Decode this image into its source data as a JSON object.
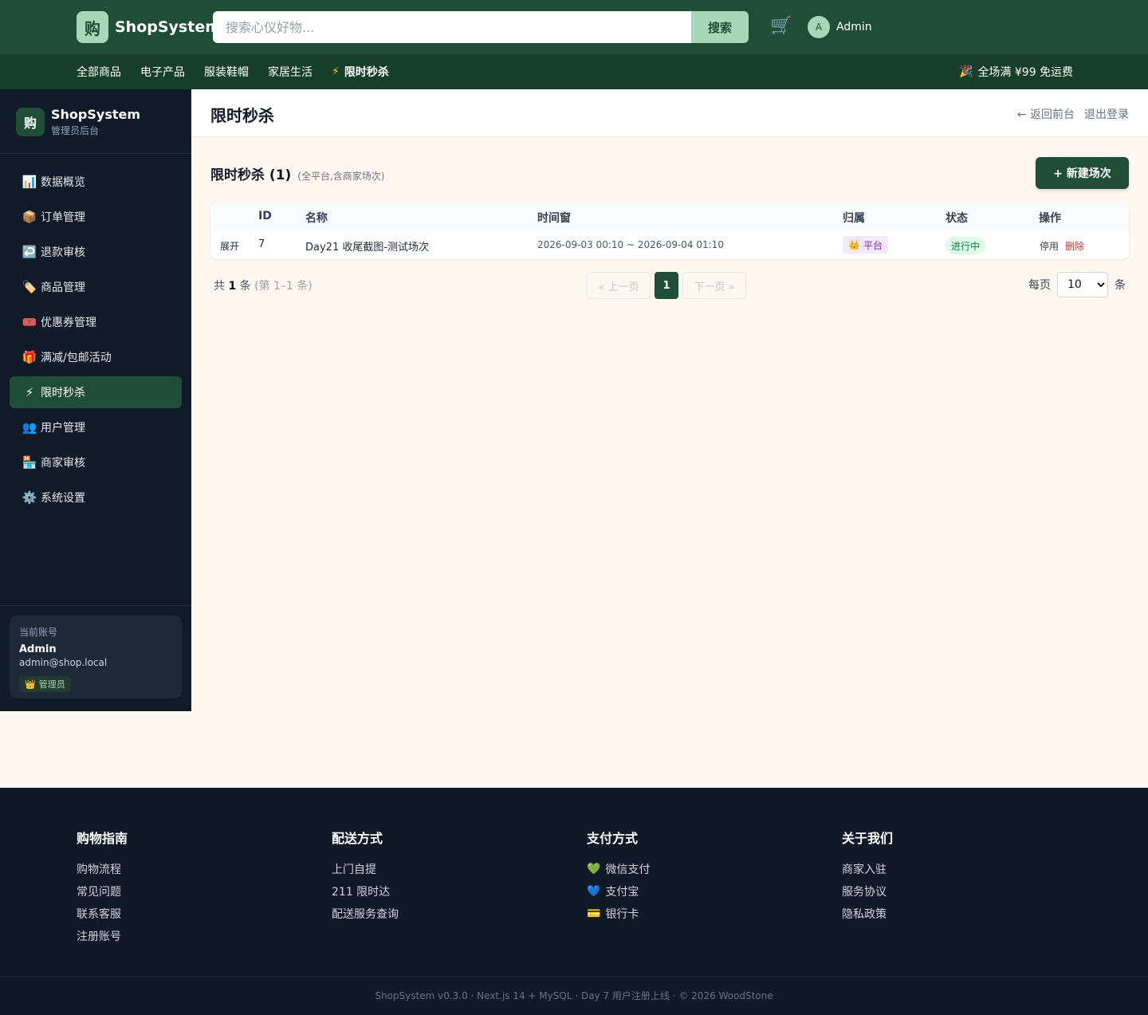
{
  "header": {
    "logo_char": "购",
    "brand": "ShopSystem",
    "search_placeholder": "搜索心仪好物...",
    "search_button": "搜索",
    "cart_icon": "🛒",
    "user_initial": "A",
    "user_name": "Admin"
  },
  "categories": [
    {
      "label": "全部商品"
    },
    {
      "label": "电子产品"
    },
    {
      "label": "服装鞋帽"
    },
    {
      "label": "家居生活"
    },
    {
      "label": "限时秒杀",
      "icon": "⚡"
    }
  ],
  "promo": {
    "icon": "🎉",
    "text": "全场满 ¥99 免运费"
  },
  "sidebar": {
    "logo_char": "购",
    "brand": "ShopSystem",
    "subtitle": "管理员后台",
    "items": [
      {
        "icon": "📊",
        "label": "数据概览"
      },
      {
        "icon": "📦",
        "label": "订单管理"
      },
      {
        "icon": "↩️",
        "label": "退款审核"
      },
      {
        "icon": "🏷️",
        "label": "商品管理"
      },
      {
        "icon": "🎟️",
        "label": "优惠券管理"
      },
      {
        "icon": "🎁",
        "label": "满减/包邮活动"
      },
      {
        "icon": "⚡",
        "label": "限时秒杀"
      },
      {
        "icon": "👥",
        "label": "用户管理"
      },
      {
        "icon": "🏪",
        "label": "商家审核"
      },
      {
        "icon": "⚙️",
        "label": "系统设置"
      }
    ],
    "account": {
      "label": "当前账号",
      "name": "Admin",
      "email": "admin@shop.local",
      "badge_icon": "👑",
      "badge": "管理员"
    }
  },
  "main": {
    "title": "限时秒杀",
    "back_link": "← 返回前台",
    "logout": "退出登录",
    "section_title": "限时秒杀 (1)",
    "section_sub": "(全平台,含商家场次)",
    "new_button": "+ 新建场次",
    "columns": {
      "id": "ID",
      "name": "名称",
      "time": "时间窗",
      "owner": "归属",
      "status": "状态",
      "ops": "操作"
    },
    "rows": [
      {
        "expand": "展开",
        "id": "7",
        "name": "Day21 收尾截图-测试场次",
        "time": "2026-09-03 00:10 ~ 2026-09-04 01:10",
        "owner_icon": "👑",
        "owner": "平台",
        "status": "进行中",
        "op_disable": "停用",
        "op_delete": "删除"
      }
    ],
    "pagination": {
      "total_prefix": "共",
      "total": "1",
      "total_suffix": "条",
      "range": "(第 1–1 条)",
      "prev": "« 上一页",
      "current": "1",
      "next": "下一页 »",
      "per_page_label": "每页",
      "per_page": "10",
      "per_page_suffix": "条"
    }
  },
  "footer": {
    "columns": [
      {
        "title": "购物指南",
        "links": [
          {
            "label": "购物流程"
          },
          {
            "label": "常见问题"
          },
          {
            "label": "联系客服"
          },
          {
            "label": "注册账号"
          }
        ]
      },
      {
        "title": "配送方式",
        "links": [
          {
            "label": "上门自提"
          },
          {
            "label": "211 限时达"
          },
          {
            "label": "配送服务查询"
          }
        ]
      },
      {
        "title": "支付方式",
        "links": [
          {
            "icon": "💚",
            "label": "微信支付"
          },
          {
            "icon": "💙",
            "label": "支付宝"
          },
          {
            "icon": "💳",
            "label": "银行卡"
          }
        ]
      },
      {
        "title": "关于我们",
        "links": [
          {
            "label": "商家入驻"
          },
          {
            "label": "服务协议"
          },
          {
            "label": "隐私政策"
          }
        ]
      }
    ],
    "copyright": "ShopSystem v0.3.0 · Next.js 14 + MySQL · Day 7 用户注册上线 · © 2026 WoodStone"
  }
}
